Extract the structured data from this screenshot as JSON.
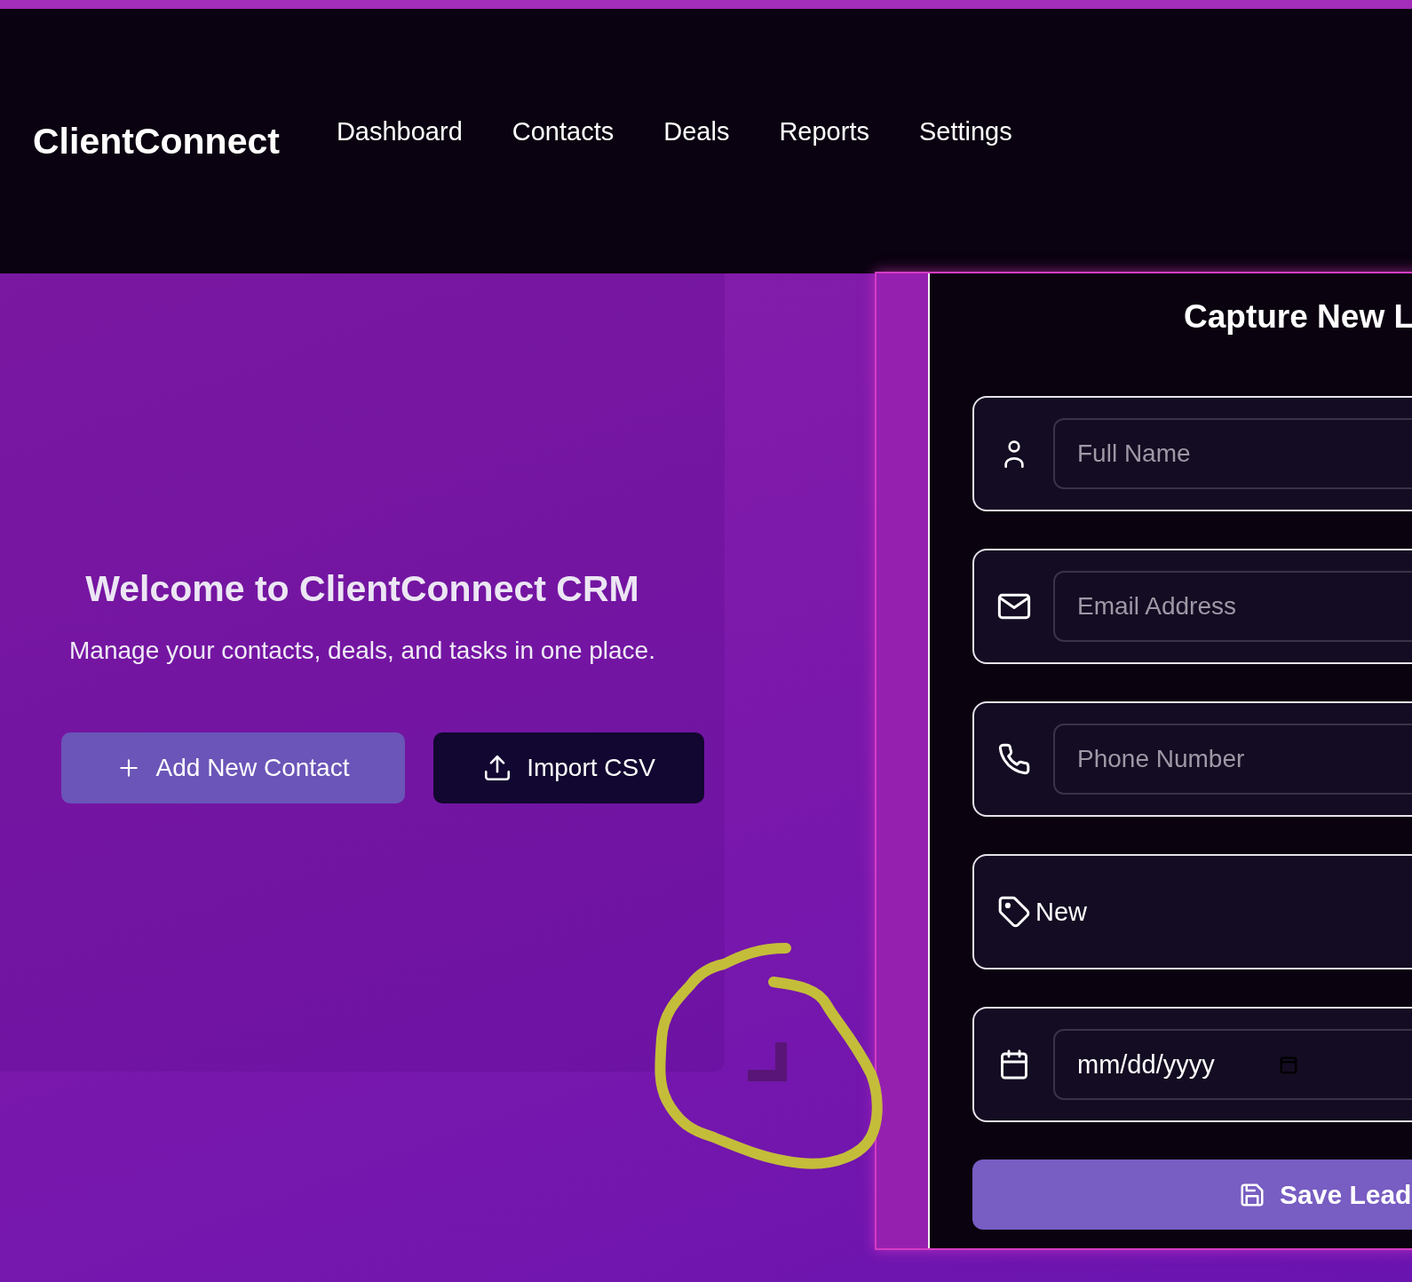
{
  "header": {
    "logo": "ClientConnect",
    "nav": [
      {
        "label": "Dashboard"
      },
      {
        "label": "Contacts"
      },
      {
        "label": "Deals"
      },
      {
        "label": "Reports"
      },
      {
        "label": "Settings"
      }
    ]
  },
  "hero": {
    "title": "Welcome to ClientConnect CRM",
    "subtitle": "Manage your contacts, deals, and tasks in one place.",
    "buttons": [
      {
        "label": "Add New Contact",
        "kind": "primary"
      },
      {
        "label": "Import CSV",
        "kind": "secondary"
      }
    ]
  },
  "lead_form": {
    "title": "Capture New L",
    "fields": [
      {
        "kind": "name",
        "placeholder": "Full Name"
      },
      {
        "kind": "email",
        "placeholder": "Email Address"
      },
      {
        "kind": "phone",
        "placeholder": "Phone Number"
      },
      {
        "kind": "status",
        "value": "New"
      },
      {
        "kind": "date",
        "placeholder": "mm/dd/yyyy"
      }
    ],
    "submit": "Save Lead"
  }
}
